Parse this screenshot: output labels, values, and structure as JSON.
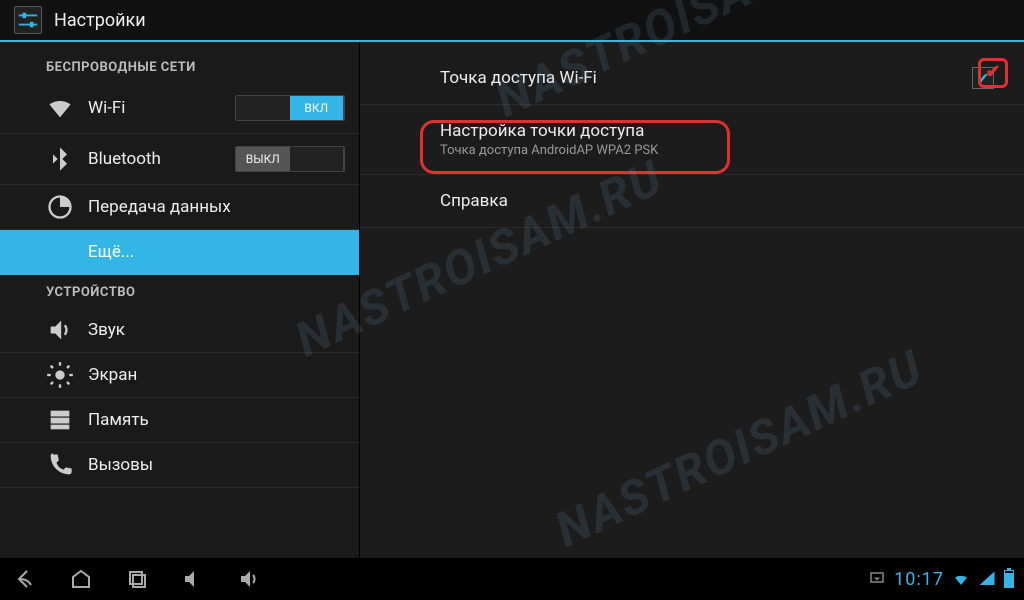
{
  "header": {
    "title": "Настройки"
  },
  "sidebar": {
    "section_wireless": "БЕСПРОВОДНЫЕ СЕТИ",
    "section_device": "УСТРОЙСТВО",
    "wifi_label": "Wi-Fi",
    "bluetooth_label": "Bluetooth",
    "data_usage_label": "Передача данных",
    "more_label": "Ещё...",
    "sound_label": "Звук",
    "display_label": "Экран",
    "storage_label": "Память",
    "calls_label": "Вызовы",
    "toggle_on": "ВКЛ",
    "toggle_off": "ВЫКЛ"
  },
  "content": {
    "hotspot_toggle_label": "Точка доступа Wi-Fi",
    "hotspot_config_title": "Настройка точки доступа",
    "hotspot_config_subtitle": "Точка доступа AndroidAP WPA2 PSK",
    "help_label": "Справка"
  },
  "status": {
    "clock": "10:17"
  },
  "watermark": "NASTROISAM.RU"
}
